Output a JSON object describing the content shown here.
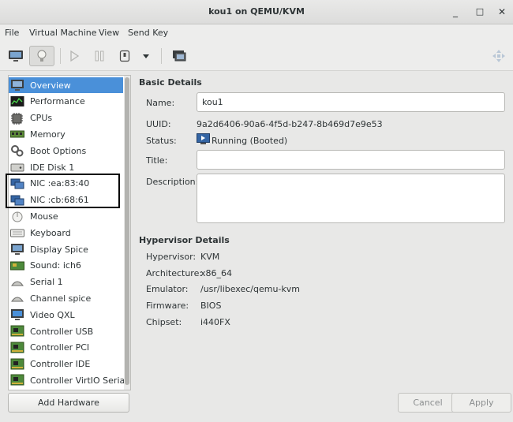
{
  "window": {
    "title": "kou1 on QEMU/KVM",
    "minimize_glyph": "_",
    "maximize_glyph": "□",
    "close_glyph": "✕"
  },
  "menu": [
    "File",
    "Virtual Machine",
    "View",
    "Send Key"
  ],
  "sidebar": {
    "items": [
      {
        "label": "Overview",
        "icon": "overview-icon"
      },
      {
        "label": "Performance",
        "icon": "performance-icon"
      },
      {
        "label": "CPUs",
        "icon": "cpu-icon"
      },
      {
        "label": "Memory",
        "icon": "memory-icon"
      },
      {
        "label": "Boot Options",
        "icon": "boot-options-icon"
      },
      {
        "label": "IDE Disk 1",
        "icon": "disk-icon"
      },
      {
        "label": "NIC :ea:83:40",
        "icon": "nic-icon"
      },
      {
        "label": "NIC :cb:68:61",
        "icon": "nic-icon"
      },
      {
        "label": "Mouse",
        "icon": "mouse-icon"
      },
      {
        "label": "Keyboard",
        "icon": "keyboard-icon"
      },
      {
        "label": "Display Spice",
        "icon": "display-icon"
      },
      {
        "label": "Sound: ich6",
        "icon": "sound-icon"
      },
      {
        "label": "Serial 1",
        "icon": "serial-icon"
      },
      {
        "label": "Channel spice",
        "icon": "channel-icon"
      },
      {
        "label": "Video QXL",
        "icon": "video-icon"
      },
      {
        "label": "Controller USB",
        "icon": "controller-icon"
      },
      {
        "label": "Controller PCI",
        "icon": "controller-icon"
      },
      {
        "label": "Controller IDE",
        "icon": "controller-icon"
      },
      {
        "label": "Controller VirtIO Serial",
        "icon": "controller-icon"
      }
    ],
    "selected": "Overview",
    "add_hardware": "Add Hardware"
  },
  "basic": {
    "heading": "Basic Details",
    "name_label": "Name:",
    "name_value": "kou1",
    "uuid_label": "UUID:",
    "uuid_value": "9a2d6406-90a6-4f5d-b247-8b469d7e9e53",
    "status_label": "Status:",
    "status_value": "Running (Booted)",
    "title_label": "Title:",
    "title_value": "",
    "description_label": "Description:",
    "description_value": ""
  },
  "hypervisor": {
    "heading": "Hypervisor Details",
    "rows": [
      {
        "label": "Hypervisor:",
        "value": "KVM"
      },
      {
        "label": "Architecture:",
        "value": "x86_64"
      },
      {
        "label": "Emulator:",
        "value": "/usr/libexec/qemu-kvm"
      },
      {
        "label": "Firmware:",
        "value": "BIOS"
      },
      {
        "label": "Chipset:",
        "value": "i440FX"
      }
    ]
  },
  "buttons": {
    "cancel": "Cancel",
    "apply": "Apply"
  },
  "colors": {
    "selection": "#4a90d9",
    "window_bg": "#e8e8e7"
  }
}
